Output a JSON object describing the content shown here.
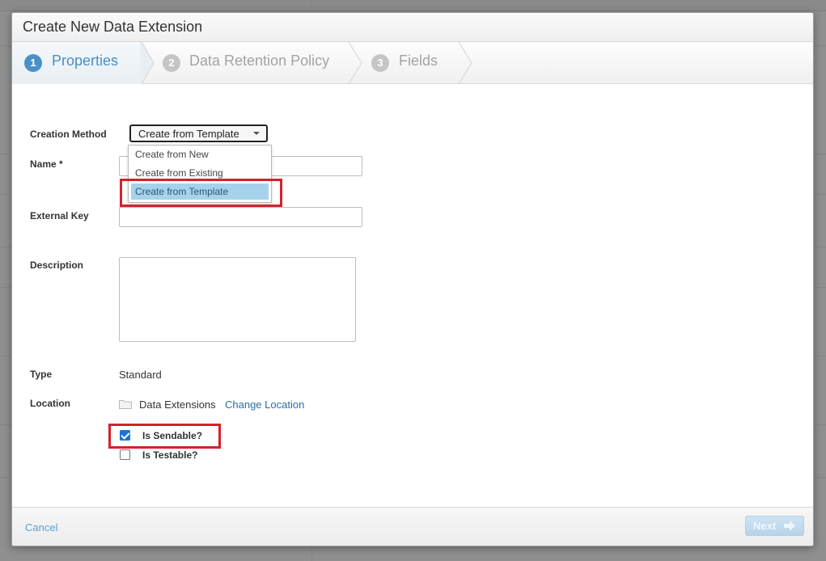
{
  "dialog": {
    "title": "Create New Data Extension"
  },
  "steps": [
    {
      "number": "1",
      "label": "Properties"
    },
    {
      "number": "2",
      "label": "Data Retention Policy"
    },
    {
      "number": "3",
      "label": "Fields"
    }
  ],
  "form": {
    "creation_method_label": "Creation Method",
    "creation_method_value": "Create from Template",
    "creation_method_options": [
      "Create from New",
      "Create from Existing",
      "Create from Template"
    ],
    "name_label": "Name *",
    "name_value": "",
    "external_key_label": "External Key",
    "external_key_value": "",
    "description_label": "Description",
    "description_value": "",
    "type_label": "Type",
    "type_value": "Standard",
    "location_label": "Location",
    "location_value": "Data Extensions",
    "change_location_label": "Change Location",
    "sendable_label": "Is Sendable?",
    "sendable_checked": true,
    "testable_label": "Is Testable?",
    "testable_checked": false
  },
  "footer": {
    "cancel_label": "Cancel",
    "next_label": "Next"
  },
  "colors": {
    "accent": "#4a90c8",
    "highlight": "#d6202e",
    "selected_option": "#a6d3ec",
    "link": "#2a6ea6"
  },
  "icons": {
    "folder": "folder-icon",
    "next_arrow": "arrow-right-icon",
    "dropdown": "caret-down-icon"
  }
}
